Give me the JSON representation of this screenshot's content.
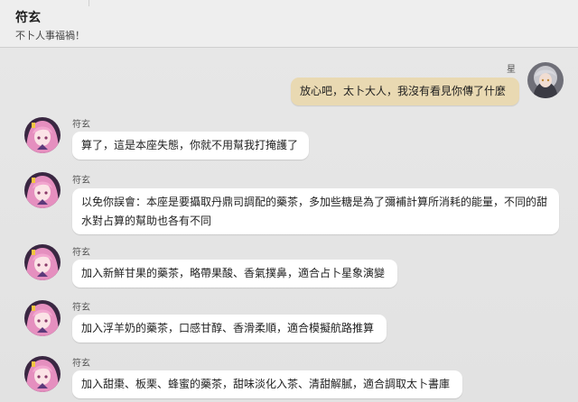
{
  "header": {
    "title": "符玄",
    "subtitle": "不卜人事福禍！"
  },
  "colors": {
    "outgoing_bubble": "#e9d9b2",
    "incoming_bubble": "#ffffff",
    "background": "#e5e5e5"
  },
  "messages": [
    {
      "sender": "星",
      "text": "放心吧，太卜大人，我沒有看見你傳了什麼",
      "avatar": "stelle-avatar"
    },
    {
      "sender": "符玄",
      "text": "算了，這是本座失態，你就不用幫我打掩護了",
      "avatar": "fu-xuan-avatar"
    },
    {
      "sender": "符玄",
      "text": "以免你誤會：本座是要攝取丹鼎司調配的藥茶，多加些糖是為了彌補計算所消耗的能量，不同的甜水對占算的幫助也各有不同",
      "avatar": "fu-xuan-avatar"
    },
    {
      "sender": "符玄",
      "text": "加入新鮮甘果的藥茶，略帶果酸、香氣撲鼻，適合占卜星象演變",
      "avatar": "fu-xuan-avatar"
    },
    {
      "sender": "符玄",
      "text": "加入浮羊奶的藥茶，口感甘醇、香滑柔順，適合模擬航路推算",
      "avatar": "fu-xuan-avatar"
    },
    {
      "sender": "符玄",
      "text": "加入甜棗、板栗、蜂蜜的藥茶，甜味淡化入茶、清甜解膩，適合調取太卜書庫",
      "avatar": "fu-xuan-avatar"
    }
  ]
}
